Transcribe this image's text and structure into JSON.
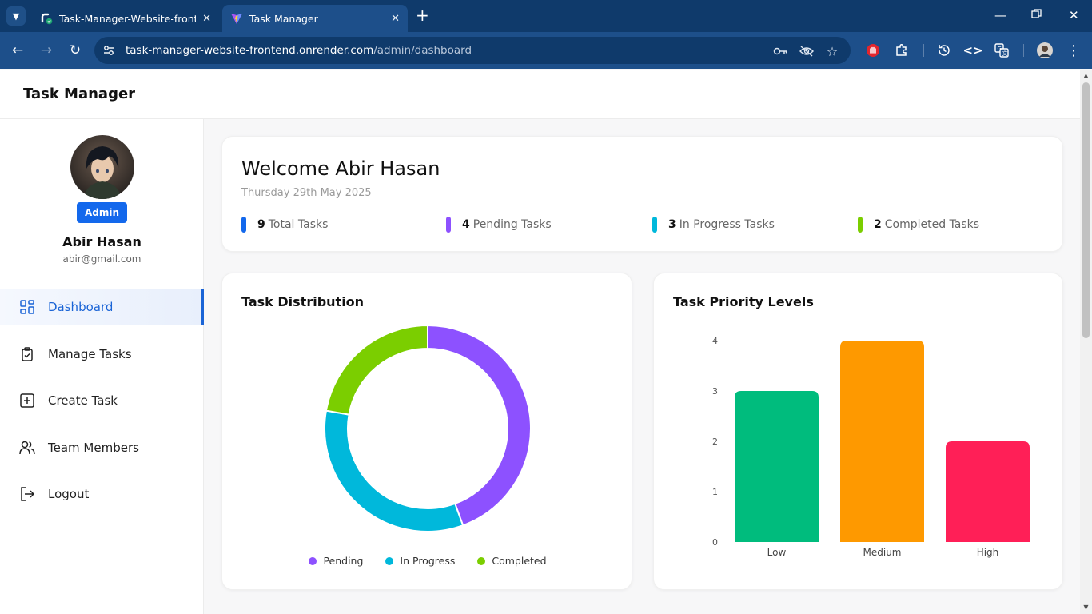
{
  "browser": {
    "tabs": [
      {
        "title": "Task-Manager-Website-frontend",
        "icon": "render-favicon"
      },
      {
        "title": "Task Manager",
        "icon": "vite-favicon"
      }
    ],
    "url_host": "task-manager-website-frontend.onrender.com",
    "url_path": "/admin/dashboard"
  },
  "app": {
    "title": "Task Manager"
  },
  "sidebar": {
    "role": "Admin",
    "name": "Abir Hasan",
    "email": "abir@gmail.com",
    "items": [
      {
        "label": "Dashboard",
        "icon": "dashboard-icon",
        "active": true
      },
      {
        "label": "Manage Tasks",
        "icon": "clipboard-check-icon"
      },
      {
        "label": "Create Task",
        "icon": "plus-square-icon"
      },
      {
        "label": "Team Members",
        "icon": "users-icon"
      },
      {
        "label": "Logout",
        "icon": "logout-icon"
      }
    ]
  },
  "welcome": {
    "title": "Welcome Abir Hasan",
    "date": "Thursday 29th May 2025",
    "stats": [
      {
        "count": "9",
        "label": "Total Tasks",
        "color": "#1368ec"
      },
      {
        "count": "4",
        "label": "Pending Tasks",
        "color": "#8d51ff"
      },
      {
        "count": "3",
        "label": "In Progress Tasks",
        "color": "#00b8db"
      },
      {
        "count": "2",
        "label": "Completed Tasks",
        "color": "#7bce00"
      }
    ]
  },
  "distribution": {
    "title": "Task Distribution"
  },
  "priority": {
    "title": "Task Priority Levels"
  },
  "chart_data": [
    {
      "type": "pie",
      "title": "Task Distribution",
      "categories": [
        "Pending",
        "In Progress",
        "Completed"
      ],
      "values": [
        4,
        3,
        2
      ],
      "colors": [
        "#8d51ff",
        "#00b8db",
        "#7bce00"
      ],
      "donut": true,
      "legend": "bottom"
    },
    {
      "type": "bar",
      "title": "Task Priority Levels",
      "categories": [
        "Low",
        "Medium",
        "High"
      ],
      "values": [
        3,
        4,
        2
      ],
      "colors": [
        "#00bc7d",
        "#fe9900",
        "#ff1f57"
      ],
      "ylim": [
        0,
        4
      ],
      "yticks": [
        "0",
        "1",
        "2",
        "3",
        "4"
      ],
      "grid": false
    }
  ]
}
